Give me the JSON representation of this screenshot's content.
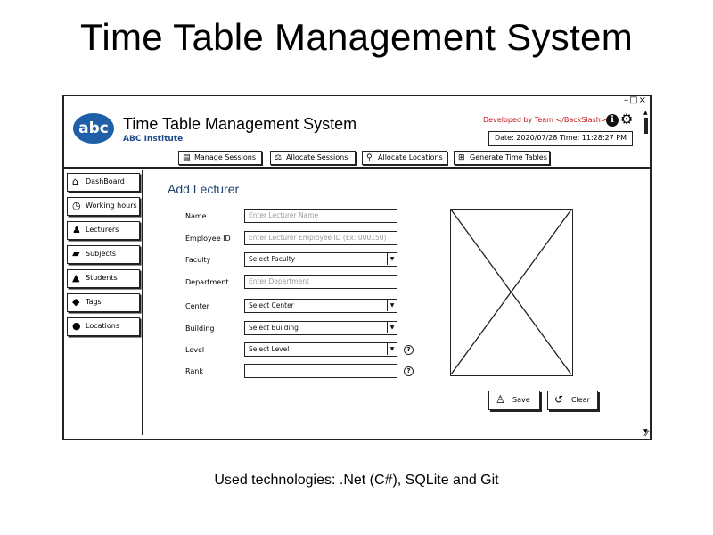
{
  "page": {
    "heading": "Time Table Management System",
    "caption": "Used technologies: .Net (C#), SQLite and Git"
  },
  "window": {
    "controls": "–□×"
  },
  "header": {
    "logo_text": "abc",
    "app_title": "Time Table Management System",
    "institute": "ABC Institute",
    "developed_by": "Developed by Team </BackSlash>",
    "info_icon": "info-icon",
    "settings_icon": "gear-icon",
    "datetime": "Date: 2020/07/28 Time: 11:28:27 PM"
  },
  "topnav": [
    {
      "label": "Manage Sessions",
      "icon": "document-icon"
    },
    {
      "label": "Allocate Sessions",
      "icon": "scale-icon"
    },
    {
      "label": "Allocate Locations",
      "icon": "map-pin-icon"
    },
    {
      "label": "Generate Time Tables",
      "icon": "plus-square-icon"
    }
  ],
  "sidebar": [
    {
      "label": "DashBoard",
      "icon": "home-icon"
    },
    {
      "label": "Working hours",
      "icon": "clock-icon"
    },
    {
      "label": "Lecturers",
      "icon": "users-icon"
    },
    {
      "label": "Subjects",
      "icon": "book-icon"
    },
    {
      "label": "Students",
      "icon": "graduation-cap-icon"
    },
    {
      "label": "Tags",
      "icon": "tags-icon"
    },
    {
      "label": "Locations",
      "icon": "map-pin-icon"
    }
  ],
  "form": {
    "title": "Add Lecturer",
    "fields": {
      "name": {
        "label": "Name",
        "placeholder": "Enter Lecturer Name"
      },
      "employee_id": {
        "label": "Employee ID",
        "placeholder": "Enter Lecturer Employee ID (Ex: 000150)"
      },
      "faculty": {
        "label": "Faculty",
        "value": "Select Faculty"
      },
      "department": {
        "label": "Department",
        "placeholder": "Enter Department"
      },
      "center": {
        "label": "Center",
        "value": "Select Center"
      },
      "building": {
        "label": "Building",
        "value": "Select Building"
      },
      "level": {
        "label": "Level",
        "value": "Select Level"
      },
      "rank": {
        "label": "Rank",
        "value": ""
      }
    },
    "save_label": "Save",
    "clear_label": "Clear"
  }
}
